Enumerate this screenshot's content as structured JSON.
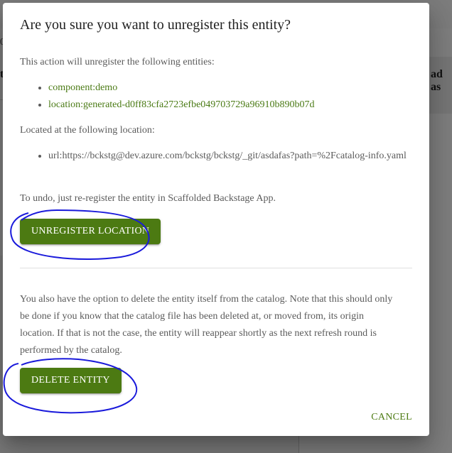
{
  "background": {
    "left_fragment": "0",
    "card_text_left": "t",
    "card_text_right": "ad as"
  },
  "dialog": {
    "title": "Are you sure you want to unregister this entity?",
    "intro": "This action will unregister the following entities:",
    "entities": [
      "component:demo",
      "location:generated-d0ff83cfa2723efbe049703729a96910b890b07d"
    ],
    "location_intro": "Located at the following location:",
    "locations": [
      "url:https://bckstg@dev.azure.com/bckstg/bckstg/_git/asdafas?path=%2Fcatalog-info.yaml"
    ],
    "undo_text": "To undo, just re-register the entity in Scaffolded Backstage App.",
    "unregister_button": "UNREGISTER LOCATION",
    "delete_description": "You also have the option to delete the entity itself from the catalog. Note that this should only be done if you know that the catalog file has been deleted at, or moved from, its origin location. If that is not the case, the entity will reappear shortly as the next refresh round is performed by the catalog.",
    "delete_button": "DELETE ENTITY",
    "cancel_button": "CANCEL"
  },
  "colors": {
    "primary": "#4c7a12",
    "link": "#4a7a14",
    "annotation": "#1a1adb"
  }
}
